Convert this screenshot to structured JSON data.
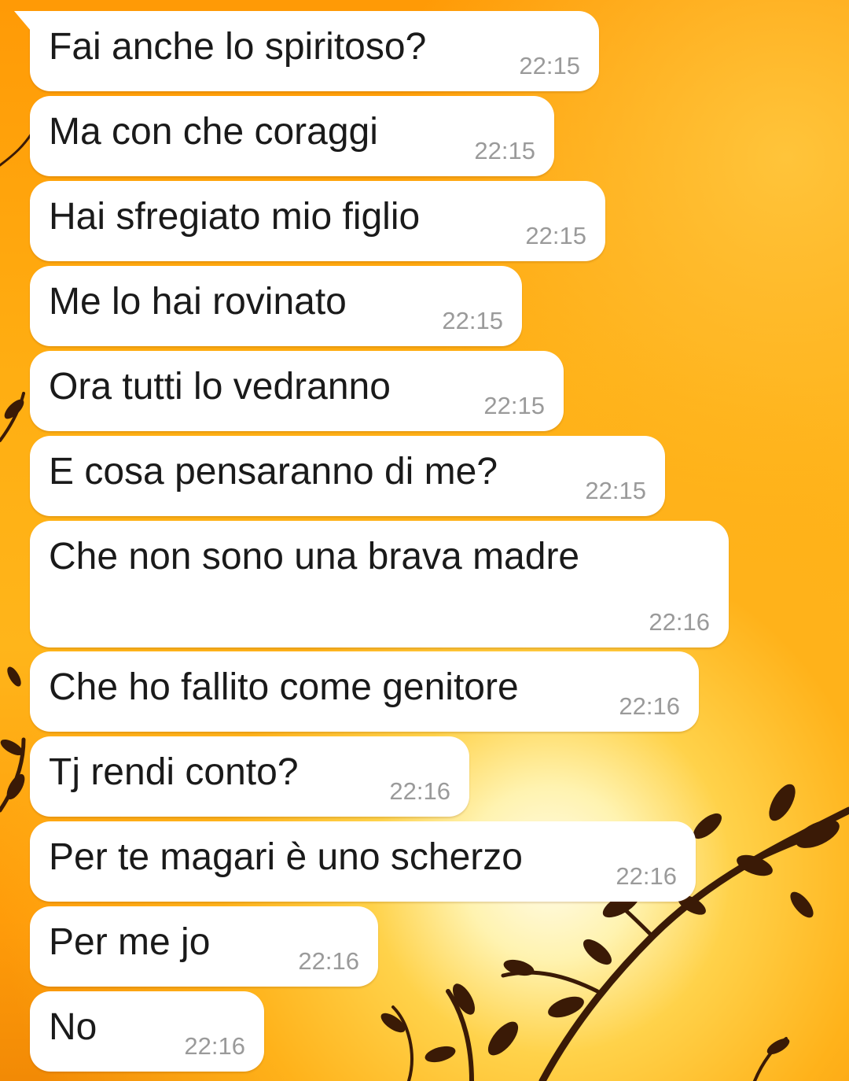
{
  "conversation": {
    "messages": [
      {
        "text": "Fai anche lo spiritoso?",
        "time": "22:15"
      },
      {
        "text": "Ma con che coraggi",
        "time": "22:15"
      },
      {
        "text": "Hai sfregiato mio figlio",
        "time": "22:15"
      },
      {
        "text": "Me lo hai rovinato",
        "time": "22:15"
      },
      {
        "text": "Ora tutti lo vedranno",
        "time": "22:15"
      },
      {
        "text": "E cosa pensaranno di me?",
        "time": "22:15"
      },
      {
        "text": "Che non sono una brava madre",
        "time": "22:16"
      },
      {
        "text": "Che ho fallito come genitore",
        "time": "22:16"
      },
      {
        "text": "Tj rendi conto?",
        "time": "22:16"
      },
      {
        "text": "Per te magari è uno scherzo",
        "time": "22:16"
      },
      {
        "text": "Per me jo",
        "time": "22:16"
      },
      {
        "text": "No",
        "time": "22:16"
      }
    ]
  }
}
